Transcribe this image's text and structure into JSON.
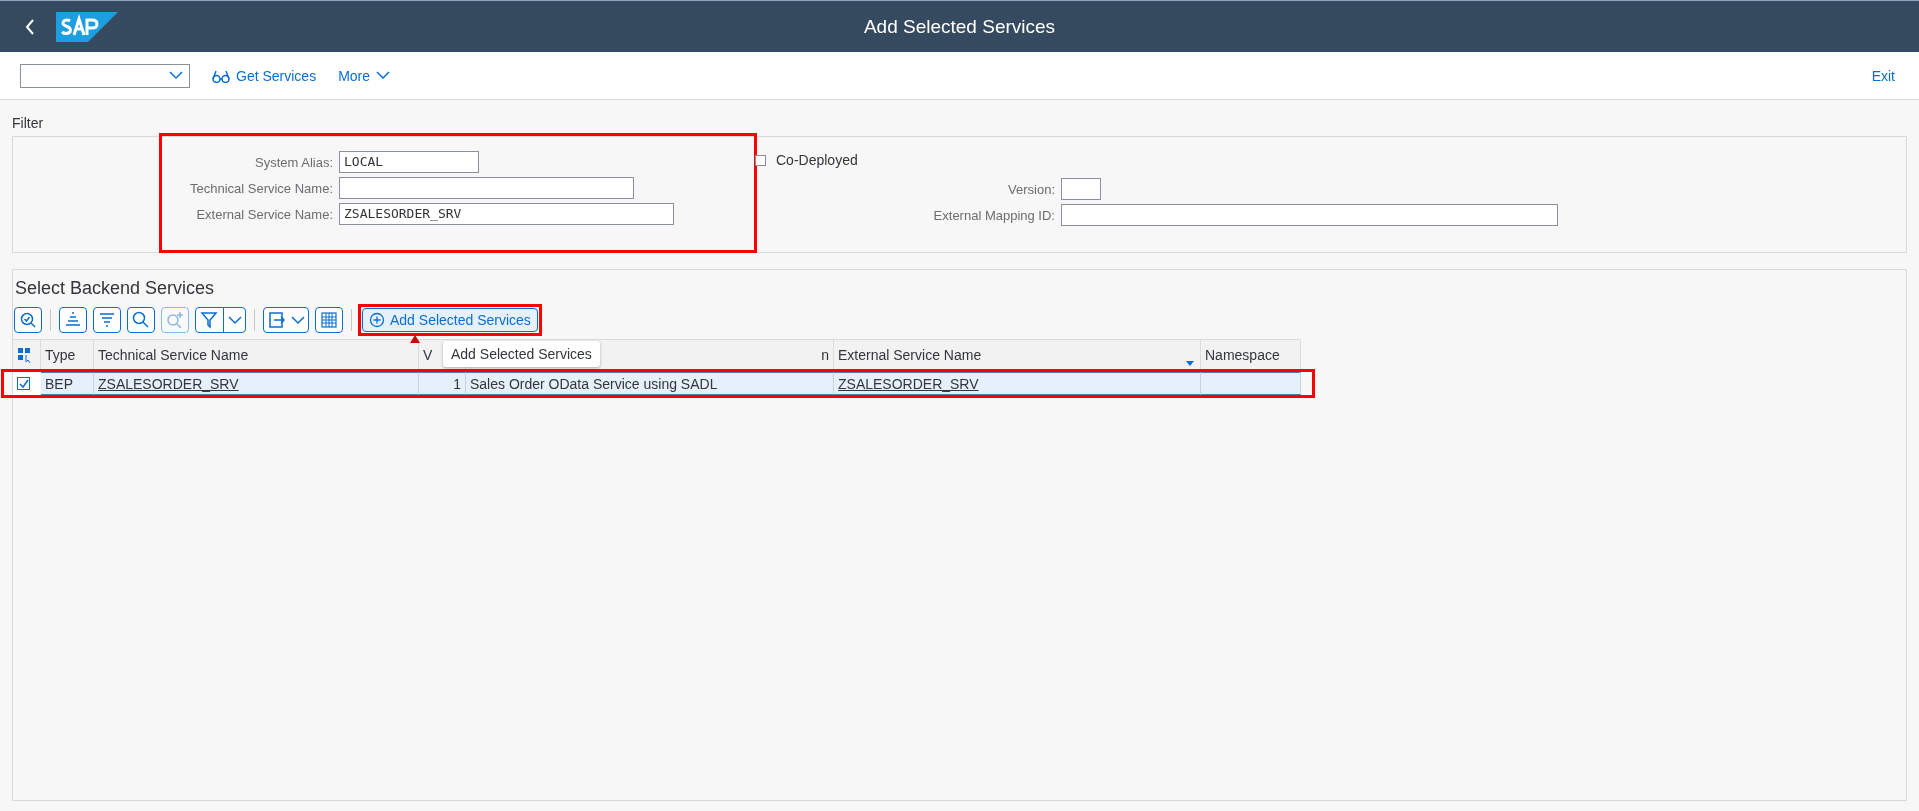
{
  "header": {
    "title": "Add Selected Services"
  },
  "toolbar": {
    "buttons": [
      {
        "label": "Get Services",
        "kind": "glasses"
      },
      {
        "label": "More",
        "kind": "menu"
      }
    ],
    "exit": "Exit"
  },
  "filter": {
    "title": "Filter",
    "highlighted": true,
    "fields": [
      {
        "label": "System Alias:",
        "value": "LOCAL"
      },
      {
        "label": "Technical Service Name:"
      },
      {
        "label": "External Service Name:",
        "value": "ZSALESORDER_SRV"
      }
    ],
    "co_deployed": {
      "label": "Co-Deployed",
      "checked": false
    },
    "right_fields": [
      {
        "label": "Version:"
      },
      {
        "label": "External Mapping ID:"
      }
    ]
  },
  "services": {
    "title": "Select Backend Services",
    "tools": [
      {
        "kind": "details",
        "disabled": false
      },
      {
        "kind": "sort-ascending",
        "disabled": false
      },
      {
        "kind": "sort-descending",
        "disabled": false
      },
      {
        "kind": "find",
        "disabled": false
      },
      {
        "kind": "find-next",
        "disabled": true
      },
      {
        "kind": "filter",
        "disabled": false
      },
      {
        "kind": "export",
        "disabled": false
      },
      {
        "kind": "layout",
        "disabled": false
      }
    ],
    "add_button": {
      "label": "Add Selected Services",
      "highlighted": true
    },
    "tooltip": "Add Selected Services",
    "columns": [
      {
        "label": "Type",
        "sorted": false
      },
      {
        "label": "Technical Service Name",
        "sorted": false
      },
      {
        "label": "V",
        "sorted": false
      },
      {
        "label": "n",
        "sorted": false
      },
      {
        "label": "External Service Name",
        "sorted": true
      },
      {
        "label": "Namespace",
        "sorted": false
      }
    ],
    "rows": [
      {
        "selected": true,
        "highlighted": true,
        "cells": [
          "BEP",
          "ZSALESORDER_SRV",
          "1",
          "Sales Order OData Service using SADL",
          "ZSALESORDER_SRV"
        ]
      }
    ]
  }
}
